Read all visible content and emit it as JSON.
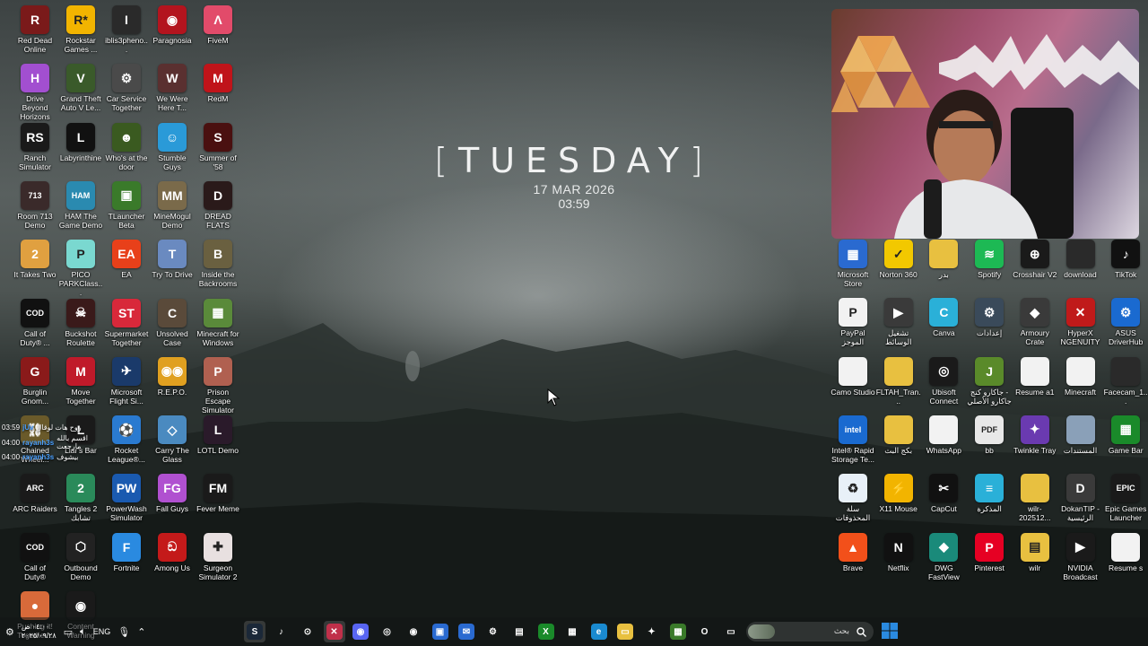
{
  "clock": {
    "day": "TUESDAY",
    "date": "17 MAR 2026",
    "time": "03:59"
  },
  "left_icons": [
    {
      "label": "Red Dead\nOnline",
      "icon": "red-dead-icon",
      "color": "#7a1a1a",
      "glyph": "R"
    },
    {
      "label": "Rockstar\nGames ...",
      "icon": "rockstar-icon",
      "color": "#f2b400",
      "glyph": "R*"
    },
    {
      "label": "iblis3pheno...",
      "icon": "iblis-icon",
      "color": "#2a2a2a",
      "glyph": "I"
    },
    {
      "label": "Paragnosia",
      "icon": "paragnosia-icon",
      "color": "#b3141e",
      "glyph": "◉"
    },
    {
      "label": "FiveM",
      "icon": "fivem-icon",
      "color": "#e24b6a",
      "glyph": "Λ"
    },
    {
      "label": "Drive Beyond\nHorizons",
      "icon": "drive-beyond-icon",
      "color": "#a24fd0",
      "glyph": "H"
    },
    {
      "label": "Grand Theft\nAuto V Le...",
      "icon": "gta-icon",
      "color": "#3a5a2a",
      "glyph": "V"
    },
    {
      "label": "Car Service\nTogether",
      "icon": "car-service-icon",
      "color": "#4a4a4a",
      "glyph": "⚙"
    },
    {
      "label": "We Were\nHere T...",
      "icon": "we-were-here-icon",
      "color": "#5a3030",
      "glyph": "W"
    },
    {
      "label": "RedM",
      "icon": "redm-icon",
      "color": "#c0141a",
      "glyph": "M"
    },
    {
      "label": "Ranch\nSimulator",
      "icon": "ranch-icon",
      "color": "#1a1a1a",
      "glyph": "RS"
    },
    {
      "label": "Labyrinthine",
      "icon": "labyrinthine-icon",
      "color": "#111111",
      "glyph": "L"
    },
    {
      "label": "Who's at the\ndoor",
      "icon": "whos-at-door-icon",
      "color": "#3a5a20",
      "glyph": "☻"
    },
    {
      "label": "Stumble\nGuys",
      "icon": "stumble-guys-icon",
      "color": "#2a9ad8",
      "glyph": "☺"
    },
    {
      "label": "Summer of\n'58",
      "icon": "summer58-icon",
      "color": "#4a1010",
      "glyph": "S"
    },
    {
      "label": "Room 713\nDemo",
      "icon": "room713-icon",
      "color": "#3a2a2a",
      "glyph": "713"
    },
    {
      "label": "HAM The\nGame Demo",
      "icon": "ham-icon",
      "color": "#2a8ab0",
      "glyph": "HAM"
    },
    {
      "label": "TLauncher\nBeta",
      "icon": "tlauncher-icon",
      "color": "#3a7a2a",
      "glyph": "▣"
    },
    {
      "label": "MineMogul\nDemo",
      "icon": "minemogul-icon",
      "color": "#7a6a4a",
      "glyph": "MM"
    },
    {
      "label": "DREAD FLATS",
      "icon": "dread-flats-icon",
      "color": "#2a1a1a",
      "glyph": "D"
    },
    {
      "label": "It Takes Two",
      "icon": "it-takes-two-icon",
      "color": "#e0a040",
      "glyph": "2"
    },
    {
      "label": "PICO\nPARKClass...",
      "icon": "pico-park-icon",
      "color": "#7ad8d0",
      "glyph": "P"
    },
    {
      "label": "EA",
      "icon": "ea-icon",
      "color": "#e8401a",
      "glyph": "EA"
    },
    {
      "label": "Try To Drive",
      "icon": "try-to-drive-icon",
      "color": "#6a8ac0",
      "glyph": "T"
    },
    {
      "label": "Inside the\nBackrooms",
      "icon": "inside-backrooms-icon",
      "color": "#6a6040",
      "glyph": "B"
    },
    {
      "label": "Call of\nDuty® ...",
      "icon": "call-of-duty-icon",
      "color": "#111111",
      "glyph": "COD"
    },
    {
      "label": "Buckshot\nRoulette",
      "icon": "buckshot-icon",
      "color": "#3a1a1a",
      "glyph": "☠"
    },
    {
      "label": "Supermarket\nTogether",
      "icon": "supermarket-icon",
      "color": "#d8283a",
      "glyph": "ST"
    },
    {
      "label": "Unsolved\nCase",
      "icon": "unsolved-case-icon",
      "color": "#5a4a3a",
      "glyph": "C"
    },
    {
      "label": "Minecraft for\nWindows",
      "icon": "minecraft-windows-icon",
      "color": "#5a8a3a",
      "glyph": "▦"
    },
    {
      "label": "Burglin\nGnom...",
      "icon": "burglin-gnomes-icon",
      "color": "#8a1a1a",
      "glyph": "G"
    },
    {
      "label": "Move\nTogether",
      "icon": "move-together-icon",
      "color": "#c01a2a",
      "glyph": "M"
    },
    {
      "label": "Microsoft\nFlight Si...",
      "icon": "flight-sim-icon",
      "color": "#1a3a6a",
      "glyph": "✈"
    },
    {
      "label": "R.E.P.O.",
      "icon": "repo-icon",
      "color": "#e0a020",
      "glyph": "◉◉"
    },
    {
      "label": "Prison Escape\nSimulator D...",
      "icon": "prison-escape-icon",
      "color": "#b06050",
      "glyph": "P"
    },
    {
      "label": "Chained\nWheel...",
      "icon": "chained-wheels-icon",
      "color": "#6a5a2a",
      "glyph": "⛓"
    },
    {
      "label": "Liar's Bar",
      "icon": "liars-bar-icon",
      "color": "#1a1a1a",
      "glyph": "L"
    },
    {
      "label": "Rocket\nLeague®...",
      "icon": "rocket-league-icon",
      "color": "#2a7ad0",
      "glyph": "⚽"
    },
    {
      "label": "Carry The\nGlass",
      "icon": "carry-glass-icon",
      "color": "#4a8ac0",
      "glyph": "◇"
    },
    {
      "label": "LOTL Demo",
      "icon": "lotl-icon",
      "color": "#2a1a2a",
      "glyph": "L"
    },
    {
      "label": "ARC Raiders",
      "icon": "arc-raiders-icon",
      "color": "#1a1a1a",
      "glyph": "ARC"
    },
    {
      "label": "Tangles 2\nتشابك",
      "icon": "tangles-icon",
      "color": "#2a8a5a",
      "glyph": "2"
    },
    {
      "label": "PowerWash\nSimulator",
      "icon": "powerwash-icon",
      "color": "#1a5ab0",
      "glyph": "PW"
    },
    {
      "label": "Fall Guys",
      "icon": "fall-guys-icon",
      "color": "#b050d0",
      "glyph": "FG"
    },
    {
      "label": "Fever Meme",
      "icon": "fever-meme-icon",
      "color": "#1a1a1a",
      "glyph": "FM"
    },
    {
      "label": "Call of\nDuty®",
      "icon": "call-of-duty-2-icon",
      "color": "#111111",
      "glyph": "COD"
    },
    {
      "label": "Outbound\nDemo",
      "icon": "outbound-icon",
      "color": "#222222",
      "glyph": "⬡"
    },
    {
      "label": "Fortnite",
      "icon": "fortnite-icon",
      "color": "#2a8ae0",
      "glyph": "F"
    },
    {
      "label": "Among Us",
      "icon": "among-us-icon",
      "color": "#c41a1a",
      "glyph": "ඞ"
    },
    {
      "label": "Surgeon\nSimulator 2",
      "icon": "surgeon-sim-icon",
      "color": "#e8e0e0",
      "glyph": "✚"
    },
    {
      "label": "Pushing it!\nTogether...",
      "icon": "pushing-it-icon",
      "color": "#d86a3a",
      "glyph": "●"
    },
    {
      "label": "Content\nWarning",
      "icon": "content-warning-icon",
      "color": "#1a1a1a",
      "glyph": "◉"
    }
  ],
  "right_icons": [
    {
      "label": "Microsoft\nStore",
      "icon": "microsoft-store-icon",
      "color": "#2a6ad0",
      "glyph": "▦"
    },
    {
      "label": "Norton 360",
      "icon": "norton-icon",
      "color": "#f2c800",
      "glyph": "✓"
    },
    {
      "label": "بدر",
      "icon": "folder-icon",
      "color": "#e8c040",
      "glyph": ""
    },
    {
      "label": "Spotify",
      "icon": "spotify-icon",
      "color": "#1db954",
      "glyph": "≋"
    },
    {
      "label": "Crosshair V2",
      "icon": "crosshair-icon",
      "color": "#1a1a1a",
      "glyph": "⊕"
    },
    {
      "label": "download",
      "icon": "download-file-icon",
      "color": "#2a2a2a",
      "glyph": ""
    },
    {
      "label": "TikTok",
      "icon": "tiktok-icon",
      "color": "#111111",
      "glyph": "♪"
    },
    {
      "label": "PayPal\nالموجز",
      "icon": "paypal-icon",
      "color": "#f2f2f2",
      "glyph": "P"
    },
    {
      "label": "تشغيل\nالوسائط",
      "icon": "media-player-icon",
      "color": "#3a3a3a",
      "glyph": "▶"
    },
    {
      "label": "Canva",
      "icon": "canva-icon",
      "color": "#2ab0d8",
      "glyph": "C"
    },
    {
      "label": "إعدادات",
      "icon": "settings-icon",
      "color": "#3a4a5a",
      "glyph": "⚙"
    },
    {
      "label": "Armoury\nCrate",
      "icon": "armoury-crate-icon",
      "color": "#3a3a3a",
      "glyph": "◆"
    },
    {
      "label": "HyperX\nNGENUITY",
      "icon": "hyperx-icon",
      "color": "#c01a1a",
      "glyph": "✕"
    },
    {
      "label": "ASUS\nDriverHub",
      "icon": "asus-driverhub-icon",
      "color": "#1a6ad0",
      "glyph": "⚙"
    },
    {
      "label": "Camo Studio",
      "icon": "camo-file-icon",
      "color": "#f2f2f2",
      "glyph": ""
    },
    {
      "label": "FLTAH_Tran...",
      "icon": "fltah-folder-icon",
      "color": "#e8c040",
      "glyph": ""
    },
    {
      "label": "Ubisoft\nConnect",
      "icon": "ubisoft-icon",
      "color": "#1a1a1a",
      "glyph": "◎"
    },
    {
      "label": "جاكارو كنج -\nجاكارو الأصلي",
      "icon": "jackaroo-icon",
      "color": "#5a8a2a",
      "glyph": "J"
    },
    {
      "label": "Resume a1",
      "icon": "resume-file-icon",
      "color": "#f2f2f2",
      "glyph": ""
    },
    {
      "label": "Minecraft",
      "icon": "minecraft-file-icon",
      "color": "#f2f2f2",
      "glyph": ""
    },
    {
      "label": "Facecam_1...",
      "icon": "facecam-icon",
      "color": "#2a2a2a",
      "glyph": ""
    },
    {
      "label": "Intel® Rapid\nStorage Te...",
      "icon": "intel-icon",
      "color": "#1a6ad0",
      "glyph": "intel"
    },
    {
      "label": "بكج البث",
      "icon": "stream-pack-icon",
      "color": "#e8c040",
      "glyph": ""
    },
    {
      "label": "WhatsApp",
      "icon": "whatsapp-file-icon",
      "color": "#f2f2f2",
      "glyph": ""
    },
    {
      "label": "bb",
      "icon": "pdf-icon",
      "color": "#e8e8e8",
      "glyph": "PDF"
    },
    {
      "label": "Twinkle Tray",
      "icon": "twinkle-tray-icon",
      "color": "#6a3ab0",
      "glyph": "✦"
    },
    {
      "label": "المستندات",
      "icon": "documents-folder-icon",
      "color": "#8aa0b8",
      "glyph": ""
    },
    {
      "label": "Game Bar",
      "icon": "game-bar-icon",
      "color": "#1a8a2a",
      "glyph": "▦"
    },
    {
      "label": "سلة\nالمحذوفات",
      "icon": "recycle-bin-icon",
      "color": "#e8f0f8",
      "glyph": "♻"
    },
    {
      "label": "X11 Mouse",
      "icon": "x11-mouse-icon",
      "color": "#f2b400",
      "glyph": "⚡"
    },
    {
      "label": "CapCut",
      "icon": "capcut-icon",
      "color": "#111111",
      "glyph": "✂"
    },
    {
      "label": "المذكرة",
      "icon": "notepad-icon",
      "color": "#2ab0d8",
      "glyph": "≡"
    },
    {
      "label": "wilr-202512...",
      "icon": "wilr-folder-icon",
      "color": "#e8c040",
      "glyph": ""
    },
    {
      "label": "DokanTIP -\nالرئيسية",
      "icon": "dokantip-icon",
      "color": "#3a3a3a",
      "glyph": "D"
    },
    {
      "label": "Epic Games\nLauncher",
      "icon": "epic-games-icon",
      "color": "#1a1a1a",
      "glyph": "EPIC"
    },
    {
      "label": "Brave",
      "icon": "brave-icon",
      "color": "#f2501a",
      "glyph": "▲"
    },
    {
      "label": "Netflix",
      "icon": "netflix-icon",
      "color": "#111111",
      "glyph": "N"
    },
    {
      "label": "DWG\nFastView",
      "icon": "dwg-fastview-icon",
      "color": "#1a8a7a",
      "glyph": "◆"
    },
    {
      "label": "Pinterest",
      "icon": "pinterest-icon",
      "color": "#e60023",
      "glyph": "P"
    },
    {
      "label": "wilr",
      "icon": "wilr-zip-icon",
      "color": "#e8c040",
      "glyph": "▤"
    },
    {
      "label": "NVIDIA\nBroadcast",
      "icon": "nvidia-broadcast-icon",
      "color": "#1a1a1a",
      "glyph": "▶"
    },
    {
      "label": "Resume s",
      "icon": "resume-s-file-icon",
      "color": "#f2f2f2",
      "glyph": ""
    }
  ],
  "chat": [
    {
      "time": "03:59",
      "user": "jUv",
      "text": "روح هات لوقال"
    },
    {
      "time": "04:00",
      "user": "rayanh3s",
      "text": "اقسم بالله مارجعت"
    },
    {
      "time": "04:00",
      "user": "rayanh3s",
      "text": "بيشوف"
    }
  ],
  "taskbar": {
    "time": "٠٤:٠٠ ص",
    "date": "٢٠٢٥/٠٩/٢٨",
    "language": "ENG",
    "search_placeholder": "بحث",
    "apps": [
      {
        "icon": "steam-icon",
        "color": "#1b2838",
        "glyph": "S"
      },
      {
        "icon": "tiktok-tb-icon",
        "color": "transparent",
        "glyph": "♪"
      },
      {
        "icon": "recorder-icon",
        "color": "transparent",
        "glyph": "⊙"
      },
      {
        "icon": "close-app-icon",
        "color": "#c0304a",
        "glyph": "✕"
      },
      {
        "icon": "discord-icon",
        "color": "#5865f2",
        "glyph": "◉"
      },
      {
        "icon": "chrome-icon",
        "color": "transparent",
        "glyph": "◎"
      },
      {
        "icon": "obs-icon",
        "color": "transparent",
        "glyph": "◉"
      },
      {
        "icon": "photos-icon",
        "color": "#2a6ad0",
        "glyph": "▣"
      },
      {
        "icon": "mail-icon",
        "color": "#2a6ad0",
        "glyph": "✉"
      },
      {
        "icon": "settings-tb-icon",
        "color": "transparent",
        "glyph": "⚙"
      },
      {
        "icon": "capture-icon",
        "color": "transparent",
        "glyph": "▤"
      },
      {
        "icon": "xbox-icon",
        "color": "#1a8a2a",
        "glyph": "X"
      },
      {
        "icon": "store-tb-icon",
        "color": "transparent",
        "glyph": "▦"
      },
      {
        "icon": "edge-icon",
        "color": "#1a8ad0",
        "glyph": "e"
      },
      {
        "icon": "file-explorer-icon",
        "color": "#e8c040",
        "glyph": "▭"
      },
      {
        "icon": "copilot-icon",
        "color": "transparent",
        "glyph": "✦"
      },
      {
        "icon": "minecraft-tb-icon",
        "color": "#3a7a2a",
        "glyph": "▦"
      },
      {
        "icon": "opera-icon",
        "color": "transparent",
        "glyph": "O"
      },
      {
        "icon": "notes-icon",
        "color": "transparent",
        "glyph": "▭"
      }
    ]
  },
  "colors": {
    "accent": "#4aa0ff",
    "windows_blue": "#2a8ae0"
  }
}
